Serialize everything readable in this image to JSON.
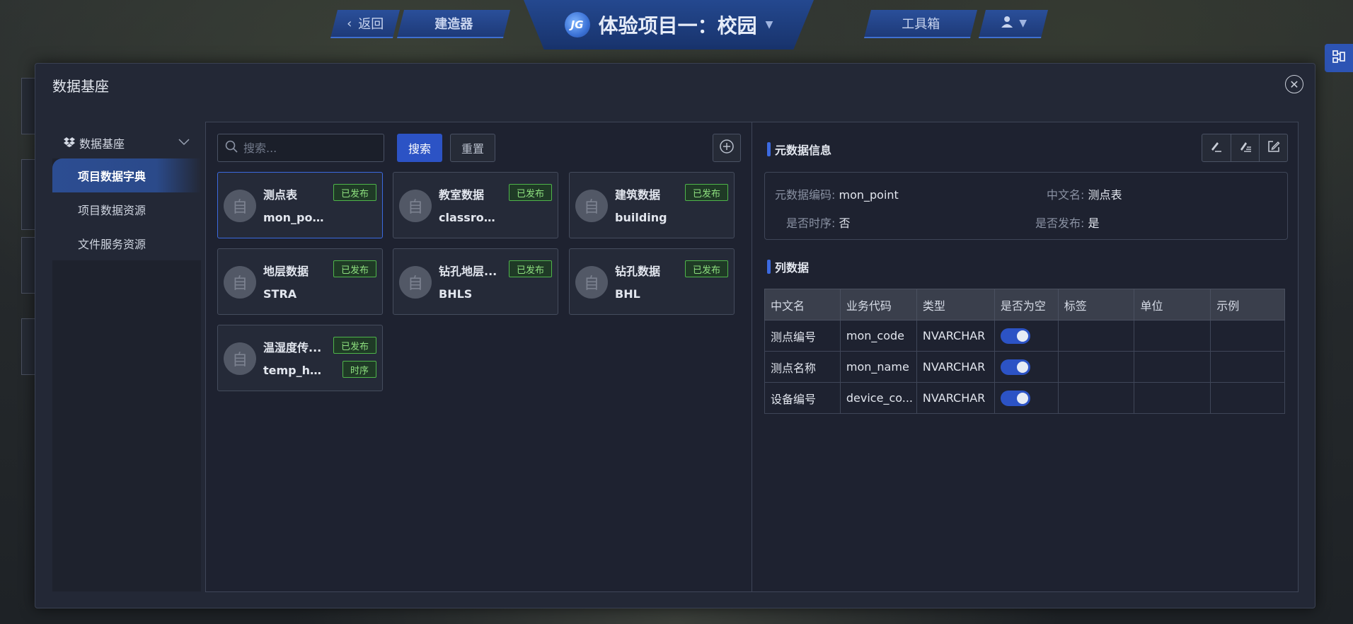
{
  "topnav": {
    "back_label": "返回",
    "builder_label": "建造器",
    "project_title": "体验项目一：校园",
    "toolbox_label": "工具箱"
  },
  "modal": {
    "title": "数据基座"
  },
  "sidebar": {
    "group_label": "数据基座",
    "items": [
      {
        "label": "项目数据字典",
        "active": true
      },
      {
        "label": "项目数据资源",
        "active": false
      },
      {
        "label": "文件服务资源",
        "active": false
      }
    ]
  },
  "search": {
    "placeholder": "搜索...",
    "search_button": "搜索",
    "reset_button": "重置"
  },
  "cards": [
    {
      "name": "测点表",
      "code": "mon_point",
      "badges": [
        "已发布"
      ],
      "selected": true
    },
    {
      "name": "教室数据",
      "code": "classroom",
      "badges": [
        "已发布"
      ],
      "selected": false
    },
    {
      "name": "建筑数据",
      "code": "building",
      "badges": [
        "已发布"
      ],
      "selected": false
    },
    {
      "name": "地层数据",
      "code": "STRA",
      "badges": [
        "已发布"
      ],
      "selected": false
    },
    {
      "name": "钻孔地层...",
      "code": "BHLS",
      "badges": [
        "已发布"
      ],
      "selected": false
    },
    {
      "name": "钻孔数据",
      "code": "BHL",
      "badges": [
        "已发布"
      ],
      "selected": false
    },
    {
      "name": "温湿度传...",
      "code": "temp_hu...",
      "badges": [
        "已发布",
        "时序"
      ],
      "selected": false
    }
  ],
  "card_avatar_glyph": "自",
  "meta": {
    "section_title": "元数据信息",
    "code_label": "元数据编码:",
    "code_value": "mon_point",
    "cn_name_label": "中文名:",
    "cn_name_value": "测点表",
    "timeseries_label": "是否时序:",
    "timeseries_value": "否",
    "published_label": "是否发布:",
    "published_value": "是"
  },
  "columns_section": {
    "title": "列数据",
    "headers": [
      "中文名",
      "业务代码",
      "类型",
      "是否为空",
      "标签",
      "单位",
      "示例"
    ],
    "rows": [
      {
        "cn": "测点编号",
        "code": "mon_code",
        "type": "NVARCHAR",
        "nullable": true,
        "tag": "",
        "unit": "",
        "example": ""
      },
      {
        "cn": "测点名称",
        "code": "mon_name",
        "type": "NVARCHAR",
        "nullable": true,
        "tag": "",
        "unit": "",
        "example": ""
      },
      {
        "cn": "设备编号",
        "code": "device_co...",
        "type": "NVARCHAR",
        "nullable": true,
        "tag": "",
        "unit": "",
        "example": ""
      }
    ]
  },
  "colors": {
    "accent": "#2c53c5",
    "badge_green": "#8ee07f",
    "nav_blue": "#24488f"
  }
}
